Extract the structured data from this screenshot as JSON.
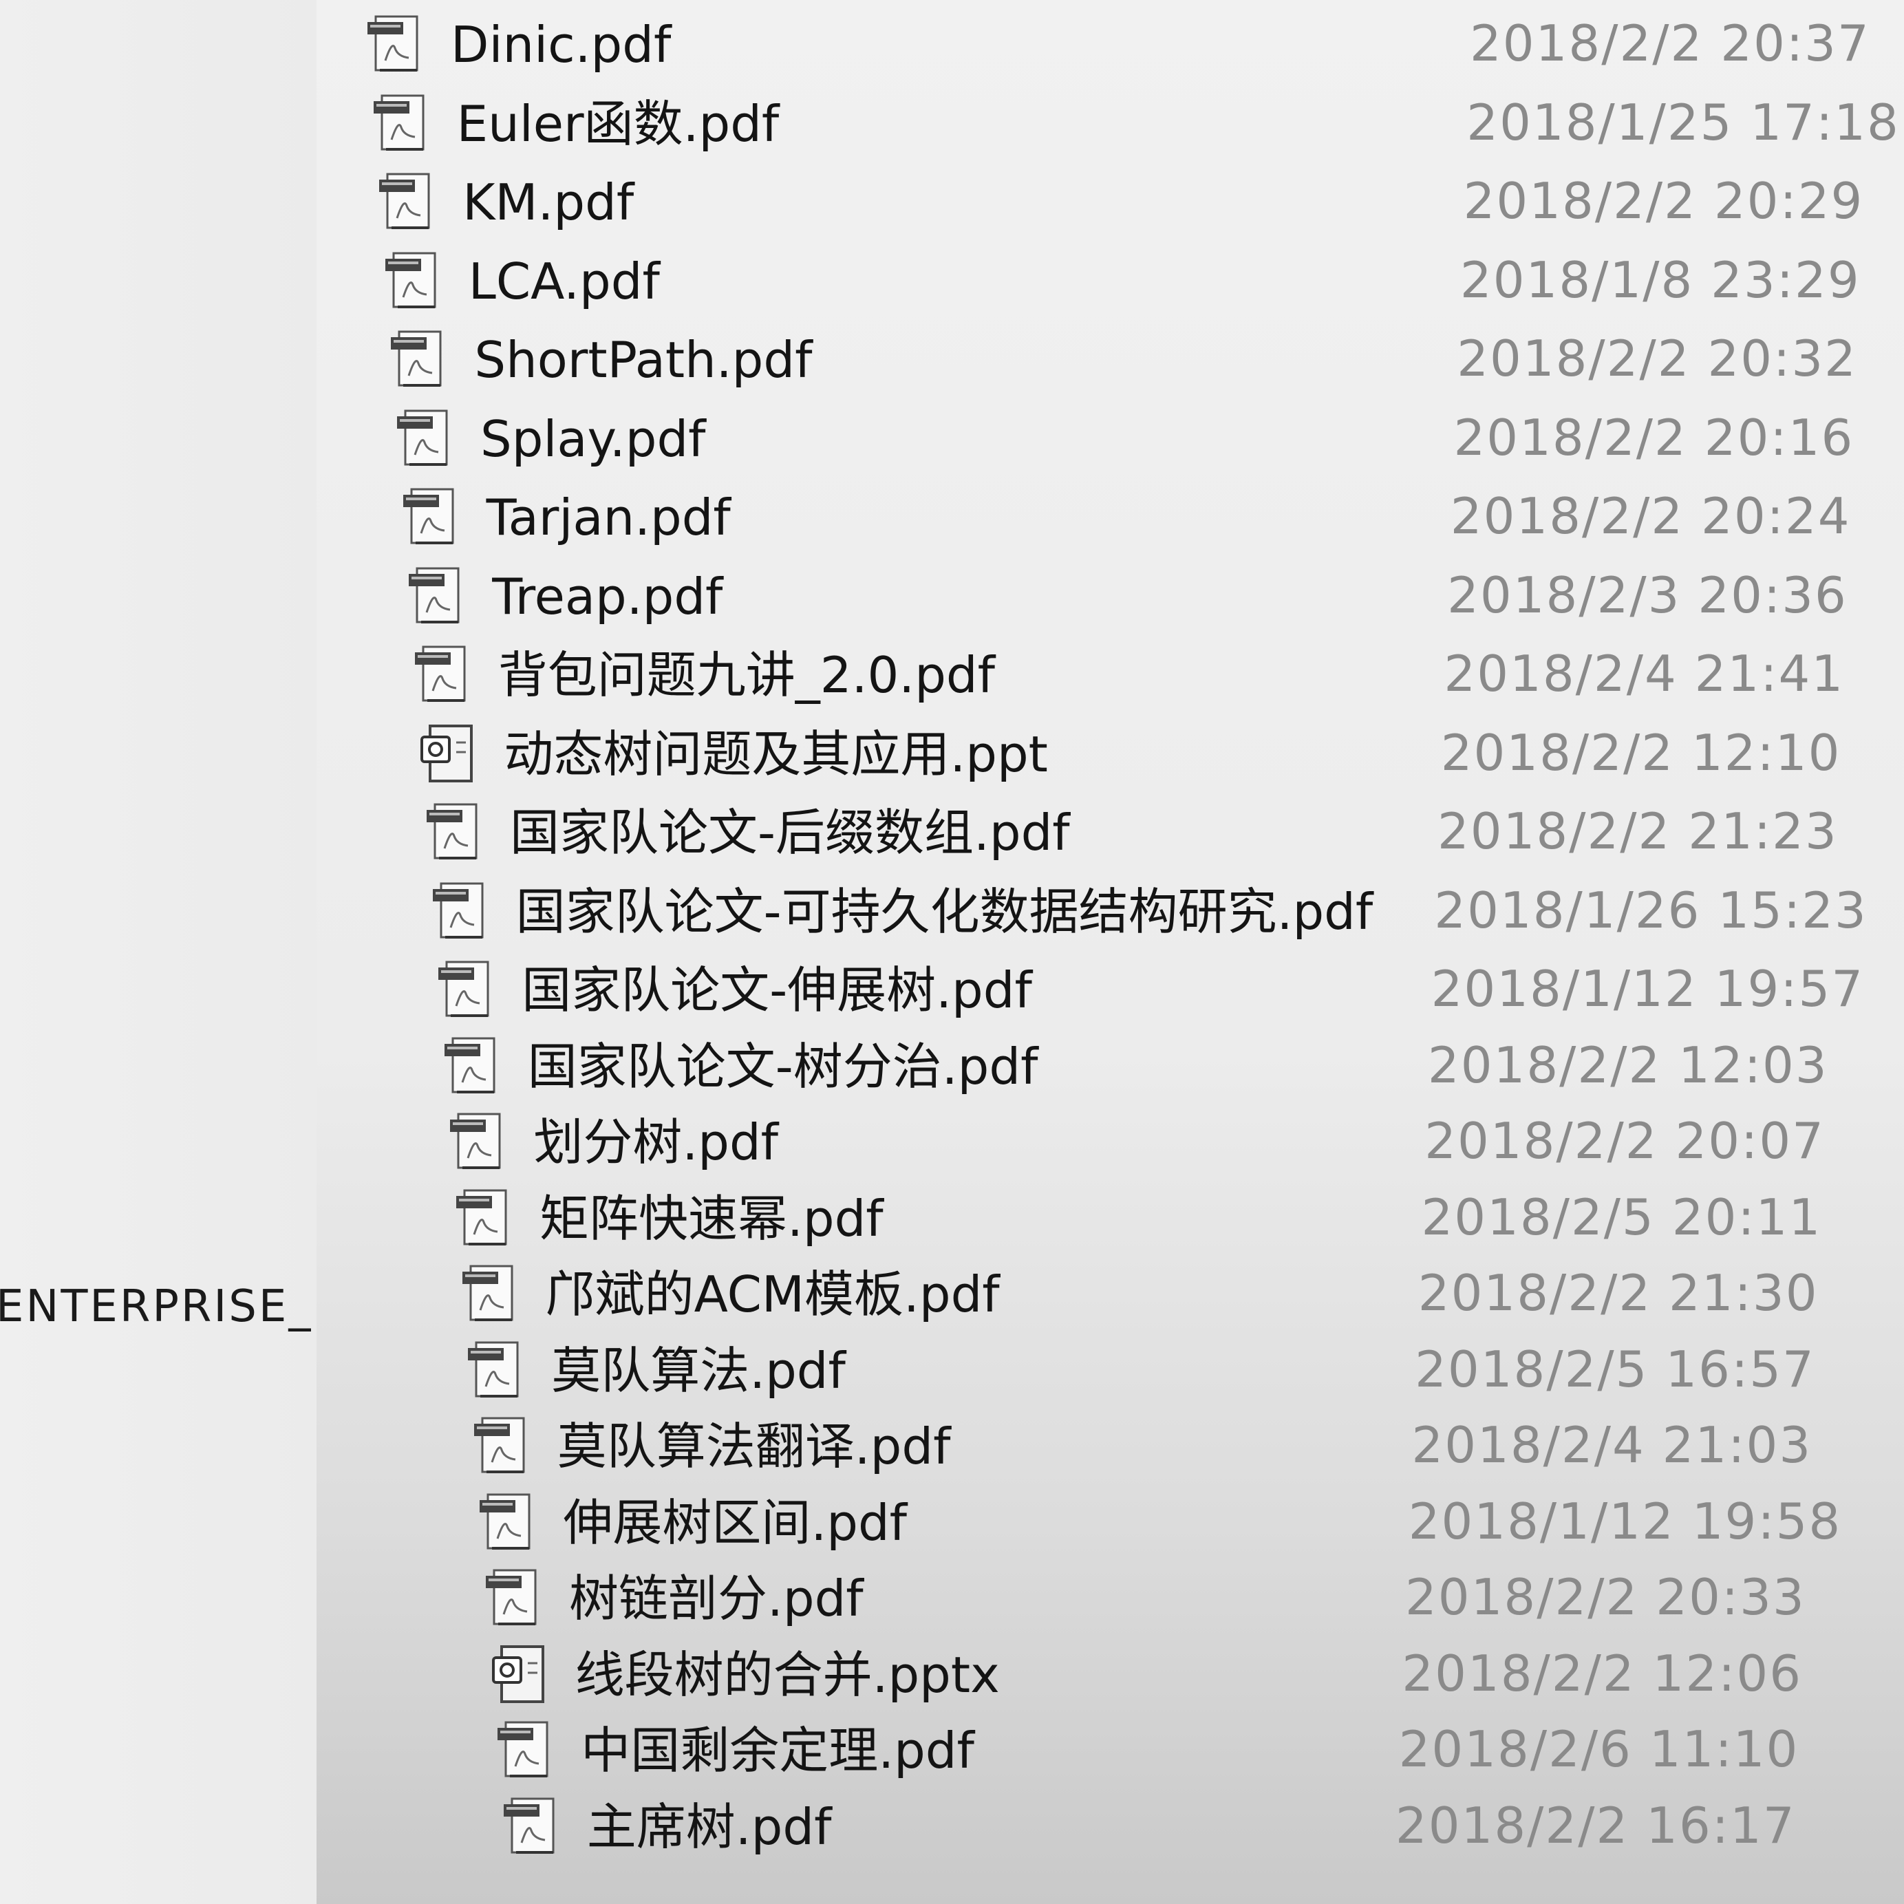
{
  "sidebar": {
    "label": "ENTERPRISE_"
  },
  "files": [
    {
      "name": "Dinic.pdf",
      "modified": "2018/2/2 20:37",
      "icon": "pdf-file-icon"
    },
    {
      "name": "Euler函数.pdf",
      "modified": "2018/1/25 17:18",
      "icon": "pdf-file-icon"
    },
    {
      "name": "KM.pdf",
      "modified": "2018/2/2 20:29",
      "icon": "pdf-file-icon"
    },
    {
      "name": "LCA.pdf",
      "modified": "2018/1/8 23:29",
      "icon": "pdf-file-icon"
    },
    {
      "name": "ShortPath.pdf",
      "modified": "2018/2/2 20:32",
      "icon": "pdf-file-icon"
    },
    {
      "name": "Splay.pdf",
      "modified": "2018/2/2 20:16",
      "icon": "pdf-file-icon"
    },
    {
      "name": "Tarjan.pdf",
      "modified": "2018/2/2 20:24",
      "icon": "pdf-file-icon"
    },
    {
      "name": "Treap.pdf",
      "modified": "2018/2/3 20:36",
      "icon": "pdf-file-icon"
    },
    {
      "name": "背包问题九讲_2.0.pdf",
      "modified": "2018/2/4 21:41",
      "icon": "pdf-file-icon"
    },
    {
      "name": "动态树问题及其应用.ppt",
      "modified": "2018/2/2 12:10",
      "icon": "ppt-file-icon"
    },
    {
      "name": "国家队论文-后缀数组.pdf",
      "modified": "2018/2/2 21:23",
      "icon": "pdf-file-icon"
    },
    {
      "name": "国家队论文-可持久化数据结构研究.pdf",
      "modified": "2018/1/26 15:23",
      "icon": "pdf-file-icon"
    },
    {
      "name": "国家队论文-伸展树.pdf",
      "modified": "2018/1/12 19:57",
      "icon": "pdf-file-icon"
    },
    {
      "name": "国家队论文-树分治.pdf",
      "modified": "2018/2/2 12:03",
      "icon": "pdf-file-icon"
    },
    {
      "name": "划分树.pdf",
      "modified": "2018/2/2 20:07",
      "icon": "pdf-file-icon"
    },
    {
      "name": "矩阵快速幂.pdf",
      "modified": "2018/2/5 20:11",
      "icon": "pdf-file-icon"
    },
    {
      "name": "邝斌的ACM模板.pdf",
      "modified": "2018/2/2 21:30",
      "icon": "pdf-file-icon"
    },
    {
      "name": "莫队算法.pdf",
      "modified": "2018/2/5 16:57",
      "icon": "pdf-file-icon"
    },
    {
      "name": "莫队算法翻译.pdf",
      "modified": "2018/2/4 21:03",
      "icon": "pdf-file-icon"
    },
    {
      "name": "伸展树区间.pdf",
      "modified": "2018/1/12 19:58",
      "icon": "pdf-file-icon"
    },
    {
      "name": "树链剖分.pdf",
      "modified": "2018/2/2 20:33",
      "icon": "pdf-file-icon"
    },
    {
      "name": "线段树的合并.pptx",
      "modified": "2018/2/2 12:06",
      "icon": "pptx-file-icon"
    },
    {
      "name": "中国剩余定理.pdf",
      "modified": "2018/2/6 11:10",
      "icon": "pdf-file-icon"
    },
    {
      "name": "主席树.pdf",
      "modified": "2018/2/2 16:17",
      "icon": "pdf-file-icon"
    }
  ]
}
